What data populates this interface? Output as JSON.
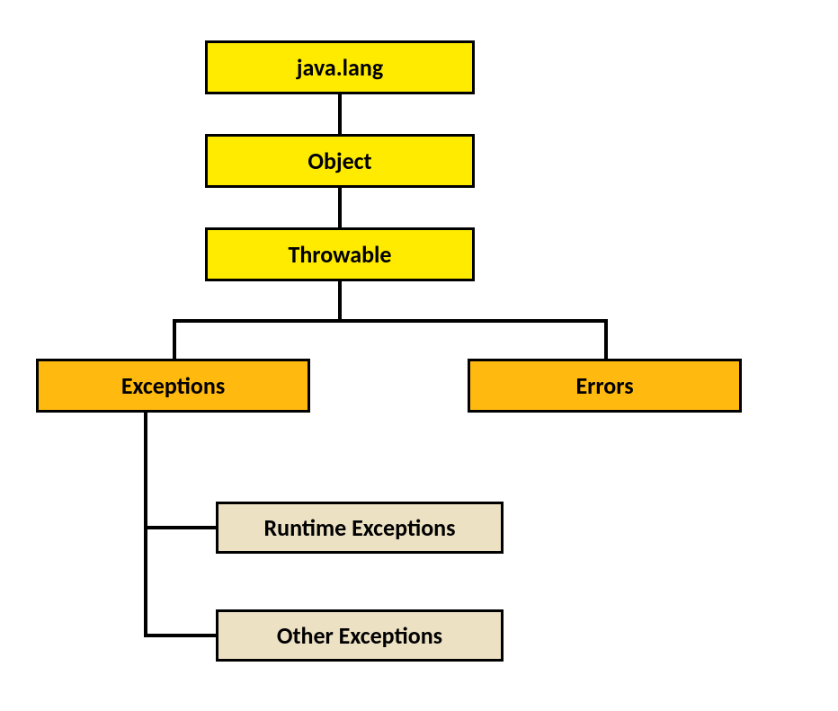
{
  "nodes": {
    "javalang": "java.lang",
    "object": "Object",
    "throwable": "Throwable",
    "exceptions": "Exceptions",
    "errors": "Errors",
    "runtime": "Runtime Exceptions",
    "other": "Other Exceptions"
  }
}
